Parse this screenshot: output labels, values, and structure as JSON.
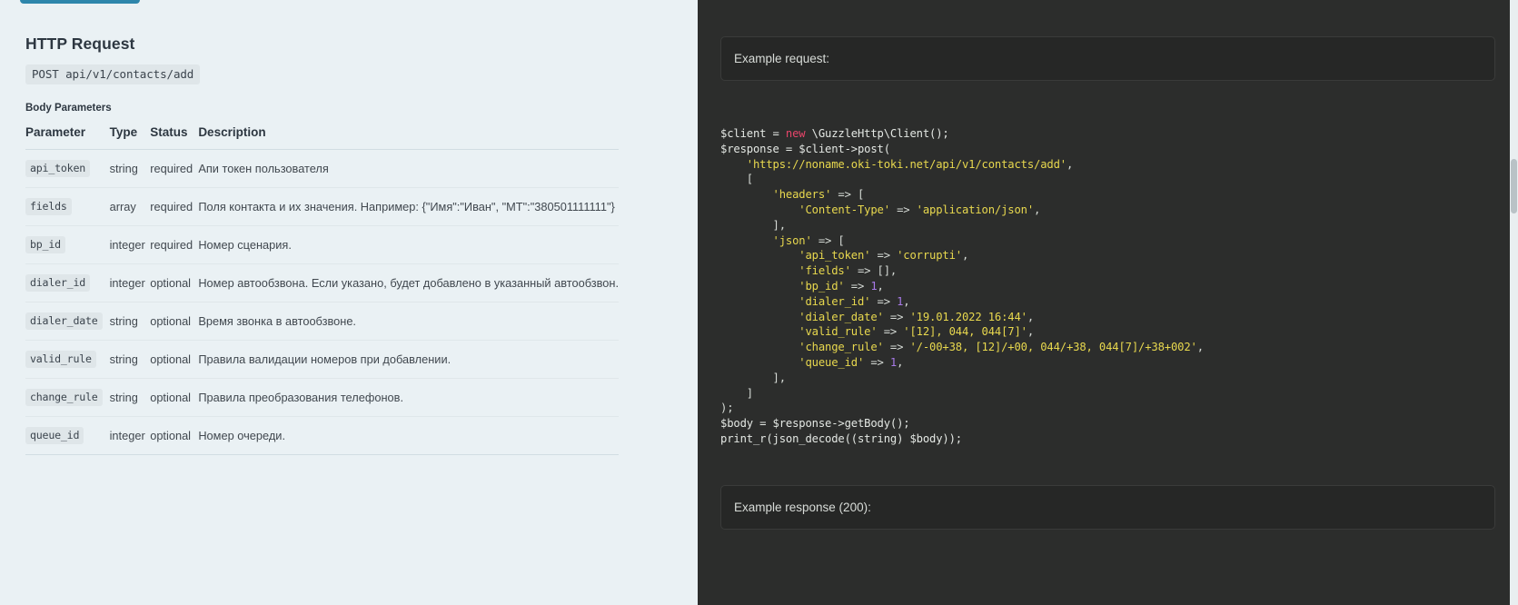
{
  "left": {
    "heading": "HTTP Request",
    "endpoint": "POST api/v1/contacts/add",
    "section_label": "Body Parameters",
    "table": {
      "headers": [
        "Parameter",
        "Type",
        "Status",
        "Description"
      ],
      "rows": [
        {
          "parameter": "api_token",
          "type": "string",
          "status": "required",
          "description": "Апи токен пользователя"
        },
        {
          "parameter": "fields",
          "type": "array",
          "status": "required",
          "description": "Поля контакта и их значения. Например: {\"Имя\":\"Иван\", \"МТ\":\"380501111111\"}"
        },
        {
          "parameter": "bp_id",
          "type": "integer",
          "status": "required",
          "description": "Номер сценария."
        },
        {
          "parameter": "dialer_id",
          "type": "integer",
          "status": "optional",
          "description": "Номер автообзвона. Если указано, будет добавлено в указанный автообзвон."
        },
        {
          "parameter": "dialer_date",
          "type": "string",
          "status": "optional",
          "description": "Время звонка в автообзвоне."
        },
        {
          "parameter": "valid_rule",
          "type": "string",
          "status": "optional",
          "description": "Правила валидации номеров при добавлении."
        },
        {
          "parameter": "change_rule",
          "type": "string",
          "status": "optional",
          "description": "Правила преобразования телефонов."
        },
        {
          "parameter": "queue_id",
          "type": "integer",
          "status": "optional",
          "description": "Номер очереди."
        }
      ]
    }
  },
  "right": {
    "request_callout": "Example request:",
    "response_callout": "Example response (200):",
    "code_lines": [
      [
        {
          "t": "$client = ",
          "c": "var"
        },
        {
          "t": "new",
          "c": "kw"
        },
        {
          "t": " \\GuzzleHttp\\Client();",
          "c": "var"
        }
      ],
      [
        {
          "t": "$response = $client->post(",
          "c": "var"
        }
      ],
      [
        {
          "t": "    ",
          "c": "punc"
        },
        {
          "t": "'https://noname.oki-toki.net/api/v1/contacts/add'",
          "c": "str"
        },
        {
          "t": ",",
          "c": "punc"
        }
      ],
      [
        {
          "t": "    [",
          "c": "punc"
        }
      ],
      [
        {
          "t": "        ",
          "c": "punc"
        },
        {
          "t": "'headers'",
          "c": "str"
        },
        {
          "t": " => [",
          "c": "punc"
        }
      ],
      [
        {
          "t": "            ",
          "c": "punc"
        },
        {
          "t": "'Content-Type'",
          "c": "str"
        },
        {
          "t": " => ",
          "c": "punc"
        },
        {
          "t": "'application/json'",
          "c": "str"
        },
        {
          "t": ",",
          "c": "punc"
        }
      ],
      [
        {
          "t": "        ],",
          "c": "punc"
        }
      ],
      [
        {
          "t": "        ",
          "c": "punc"
        },
        {
          "t": "'json'",
          "c": "str"
        },
        {
          "t": " => [",
          "c": "punc"
        }
      ],
      [
        {
          "t": "            ",
          "c": "punc"
        },
        {
          "t": "'api_token'",
          "c": "str"
        },
        {
          "t": " => ",
          "c": "punc"
        },
        {
          "t": "'corrupti'",
          "c": "str"
        },
        {
          "t": ",",
          "c": "punc"
        }
      ],
      [
        {
          "t": "            ",
          "c": "punc"
        },
        {
          "t": "'fields'",
          "c": "str"
        },
        {
          "t": " => [],",
          "c": "punc"
        }
      ],
      [
        {
          "t": "            ",
          "c": "punc"
        },
        {
          "t": "'bp_id'",
          "c": "str"
        },
        {
          "t": " => ",
          "c": "punc"
        },
        {
          "t": "1",
          "c": "num"
        },
        {
          "t": ",",
          "c": "punc"
        }
      ],
      [
        {
          "t": "            ",
          "c": "punc"
        },
        {
          "t": "'dialer_id'",
          "c": "str"
        },
        {
          "t": " => ",
          "c": "punc"
        },
        {
          "t": "1",
          "c": "num"
        },
        {
          "t": ",",
          "c": "punc"
        }
      ],
      [
        {
          "t": "            ",
          "c": "punc"
        },
        {
          "t": "'dialer_date'",
          "c": "str"
        },
        {
          "t": " => ",
          "c": "punc"
        },
        {
          "t": "'19.01.2022 16:44'",
          "c": "str"
        },
        {
          "t": ",",
          "c": "punc"
        }
      ],
      [
        {
          "t": "            ",
          "c": "punc"
        },
        {
          "t": "'valid_rule'",
          "c": "str"
        },
        {
          "t": " => ",
          "c": "punc"
        },
        {
          "t": "'[12], 044, 044[7]'",
          "c": "str"
        },
        {
          "t": ",",
          "c": "punc"
        }
      ],
      [
        {
          "t": "            ",
          "c": "punc"
        },
        {
          "t": "'change_rule'",
          "c": "str"
        },
        {
          "t": " => ",
          "c": "punc"
        },
        {
          "t": "'/-00+38, [12]/+00, 044/+38, 044[7]/+38+002'",
          "c": "str"
        },
        {
          "t": ",",
          "c": "punc"
        }
      ],
      [
        {
          "t": "            ",
          "c": "punc"
        },
        {
          "t": "'queue_id'",
          "c": "str"
        },
        {
          "t": " => ",
          "c": "punc"
        },
        {
          "t": "1",
          "c": "num"
        },
        {
          "t": ",",
          "c": "punc"
        }
      ],
      [
        {
          "t": "        ],",
          "c": "punc"
        }
      ],
      [
        {
          "t": "    ]",
          "c": "punc"
        }
      ],
      [
        {
          "t": ");",
          "c": "punc"
        }
      ],
      [
        {
          "t": "$body = $response->getBody();",
          "c": "var"
        }
      ],
      [
        {
          "t": "print_r(json_decode((string) $body));",
          "c": "var"
        }
      ]
    ]
  },
  "colors": {
    "left_bg": "#eaf1f4",
    "right_bg": "#2c2d2c",
    "callout_bg": "#262726",
    "accent_button": "#2e86ab",
    "keyword": "#e8456a",
    "string": "#e8d84e",
    "number": "#a87ae8"
  }
}
